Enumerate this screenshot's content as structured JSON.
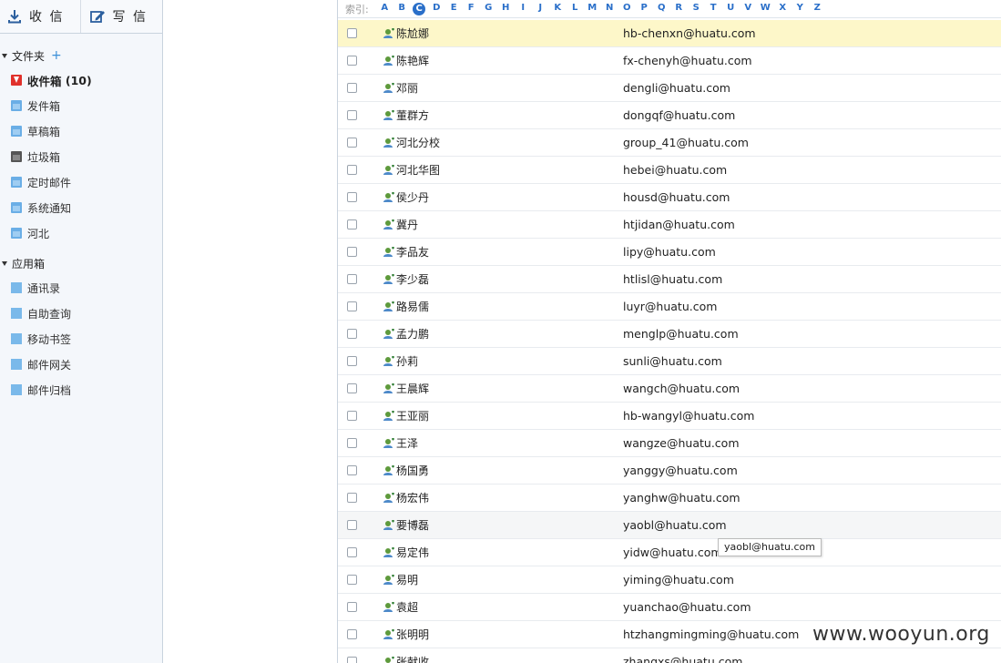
{
  "toolbar": {
    "receive_label": "收 信",
    "compose_label": "写 信"
  },
  "folders": {
    "title": "文件夹",
    "add_symbol": "+",
    "items": [
      {
        "label": "收件箱",
        "count": "(10)",
        "icon": "inbox-icon"
      },
      {
        "label": "发件箱",
        "icon": "folder-icon"
      },
      {
        "label": "草稿箱",
        "icon": "folder-icon"
      },
      {
        "label": "垃圾箱",
        "icon": "trash-icon"
      },
      {
        "label": "定时邮件",
        "icon": "folder-icon"
      },
      {
        "label": "系统通知",
        "icon": "folder-icon"
      },
      {
        "label": "河北",
        "icon": "folder-icon"
      }
    ]
  },
  "apps": {
    "title": "应用箱",
    "items": [
      {
        "label": "通讯录"
      },
      {
        "label": "自助查询"
      },
      {
        "label": "移动书签"
      },
      {
        "label": "邮件网关"
      },
      {
        "label": "邮件归档"
      }
    ]
  },
  "index": {
    "label": "索引:",
    "active": "C",
    "letters": [
      "A",
      "B",
      "C",
      "D",
      "E",
      "F",
      "G",
      "H",
      "I",
      "J",
      "K",
      "L",
      "M",
      "N",
      "O",
      "P",
      "Q",
      "R",
      "S",
      "T",
      "U",
      "V",
      "W",
      "X",
      "Y",
      "Z"
    ]
  },
  "contacts": [
    {
      "name": "陈尬娜",
      "email": "hb-chenxn@huatu.com"
    },
    {
      "name": "陈艳辉",
      "email": "fx-chenyh@huatu.com"
    },
    {
      "name": "邓丽",
      "email": "dengli@huatu.com"
    },
    {
      "name": "董群方",
      "email": "dongqf@huatu.com"
    },
    {
      "name": "河北分校",
      "email": "group_41@huatu.com"
    },
    {
      "name": "河北华图",
      "email": "hebei@huatu.com"
    },
    {
      "name": "侯少丹",
      "email": "housd@huatu.com"
    },
    {
      "name": "冀丹",
      "email": "htjidan@huatu.com"
    },
    {
      "name": "李品友",
      "email": "lipy@huatu.com"
    },
    {
      "name": "李少磊",
      "email": "htlisl@huatu.com"
    },
    {
      "name": "路易儒",
      "email": "luyr@huatu.com"
    },
    {
      "name": "孟力鹏",
      "email": "menglp@huatu.com"
    },
    {
      "name": "孙莉",
      "email": "sunli@huatu.com"
    },
    {
      "name": "王晨辉",
      "email": "wangch@huatu.com"
    },
    {
      "name": "王亚丽",
      "email": "hb-wangyl@huatu.com"
    },
    {
      "name": "王泽",
      "email": "wangze@huatu.com"
    },
    {
      "name": "杨国勇",
      "email": "yanggy@huatu.com"
    },
    {
      "name": "杨宏伟",
      "email": "yanghw@huatu.com"
    },
    {
      "name": "要博磊",
      "email": "yaobl@huatu.com"
    },
    {
      "name": "易定伟",
      "email": "yidw@huatu.com"
    },
    {
      "name": "易明",
      "email": "yiming@huatu.com"
    },
    {
      "name": "袁超",
      "email": "yuanchao@huatu.com"
    },
    {
      "name": "张明明",
      "email": "htzhangmingming@huatu.com"
    },
    {
      "name": "张献收",
      "email": "zhangxs@huatu.com"
    }
  ],
  "highlighted_row": 0,
  "hovered_row": 18,
  "tooltip": "yaobl@huatu.com",
  "watermark": "www.wooyun.org",
  "colors": {
    "accent": "#2a6fc9",
    "highlight": "#fdf7c9",
    "inbox_red": "#e0312b",
    "folder_blue": "#6aaee6"
  }
}
